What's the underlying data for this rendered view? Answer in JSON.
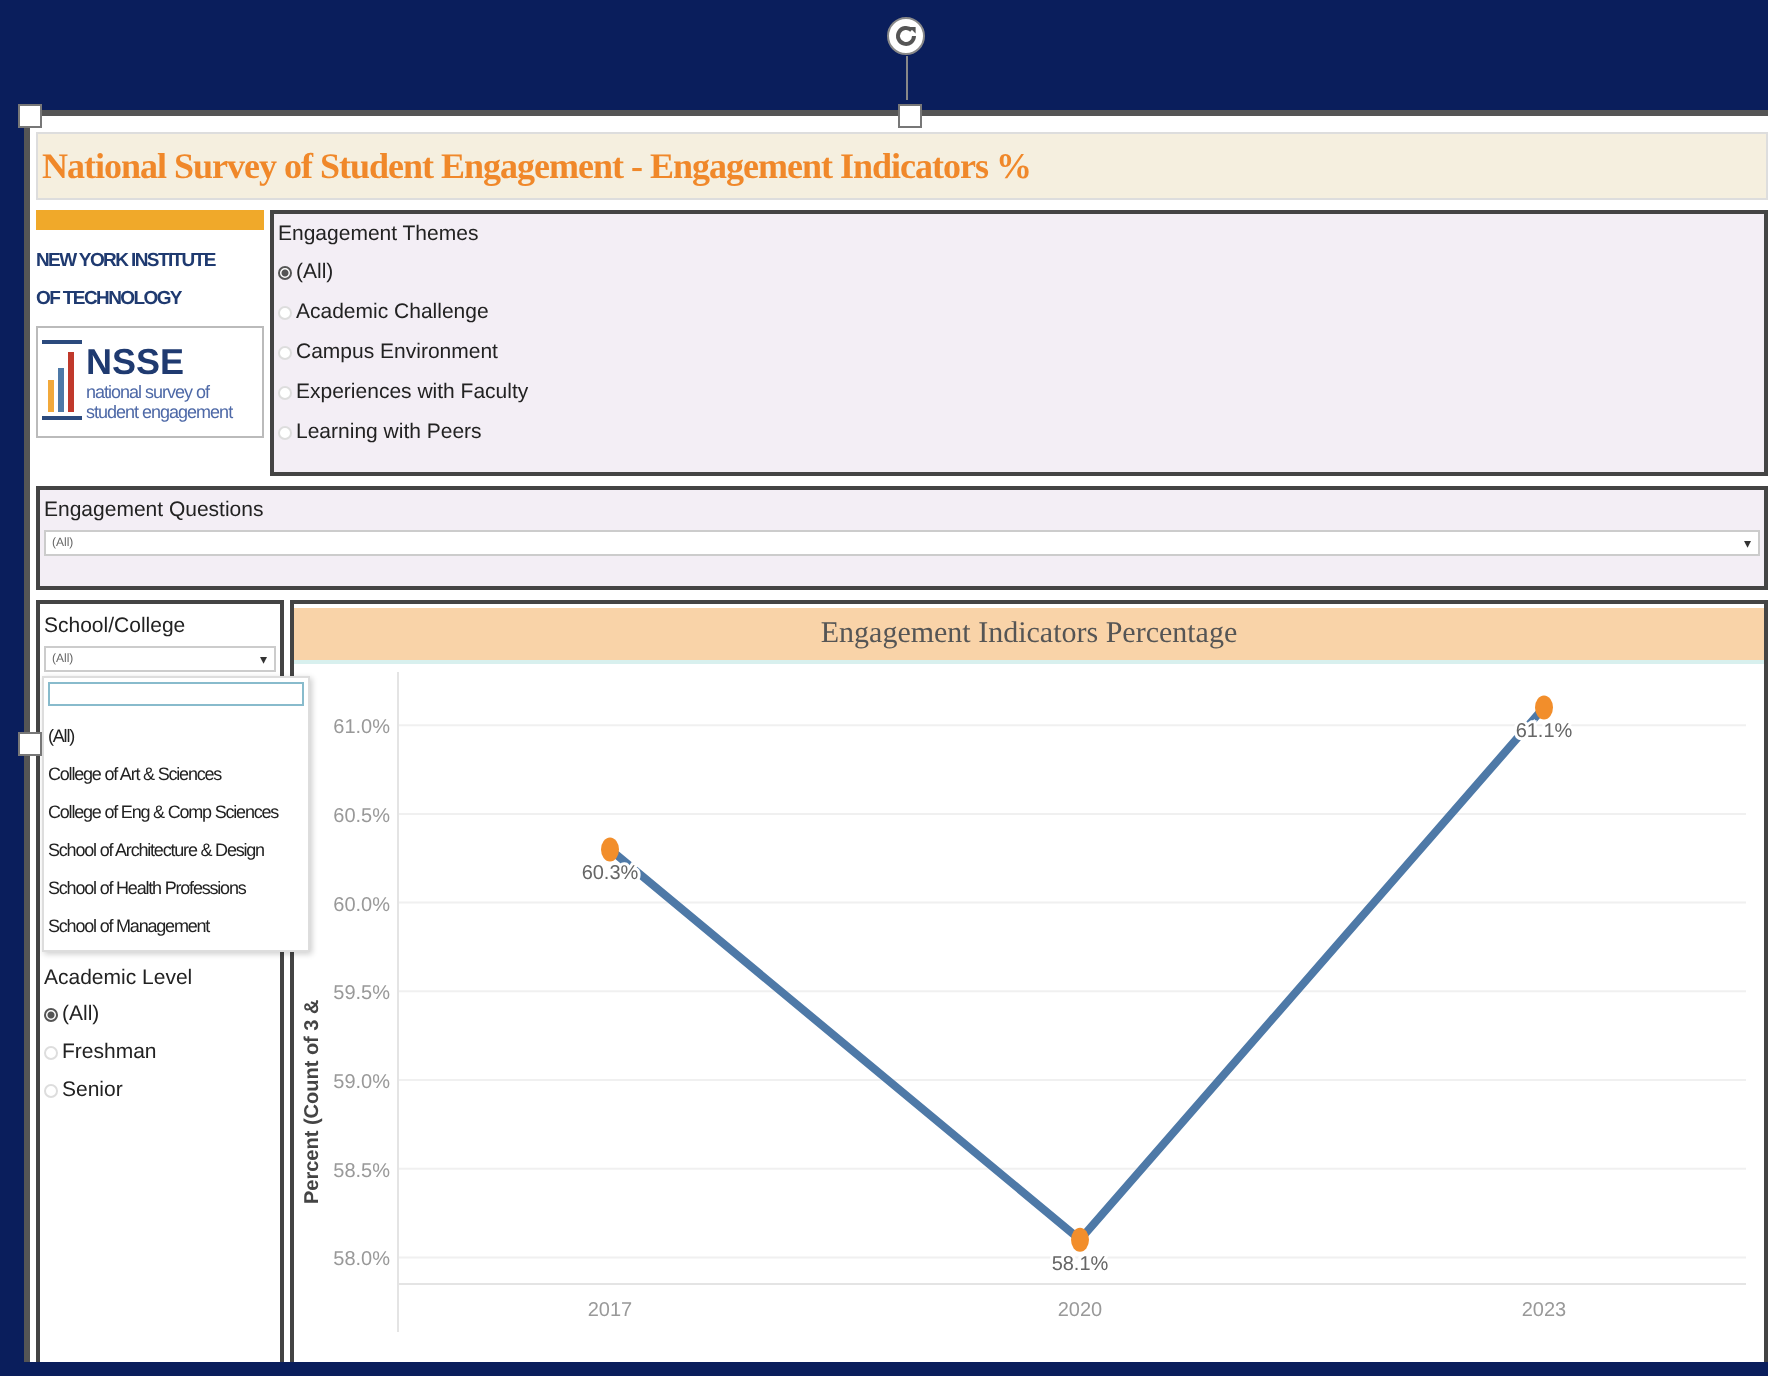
{
  "title": "National Survey of Student Engagement - Engagement Indicators %",
  "logo": {
    "institute_lines": [
      "NEW YORK INSTITUTE",
      "OF TECHNOLOGY"
    ],
    "acronym": "NSSE",
    "tagline_lines": [
      "national survey of",
      "student engagement"
    ]
  },
  "engagement_themes": {
    "label": "Engagement Themes",
    "options": [
      {
        "label": "(All)",
        "selected": true
      },
      {
        "label": "Academic Challenge",
        "selected": false
      },
      {
        "label": "Campus Environment",
        "selected": false
      },
      {
        "label": "Experiences with Faculty",
        "selected": false
      },
      {
        "label": "Learning with Peers",
        "selected": false
      }
    ]
  },
  "engagement_questions": {
    "label": "Engagement Questions",
    "value": "(All)",
    "caret": "▾"
  },
  "school_college": {
    "label": "School/College",
    "value": "(All)",
    "caret": "▾",
    "dropdown": {
      "expanded": true,
      "items": [
        {
          "label": "(All)"
        },
        {
          "label": "College of Art & Sciences"
        },
        {
          "label": "College of Eng & Comp Sciences"
        },
        {
          "label": "School of Architecture & Design"
        },
        {
          "label": "School of Health Professions"
        },
        {
          "label": "School of Management"
        }
      ]
    }
  },
  "academic_level": {
    "label": "Academic Level",
    "options": [
      {
        "label": "(All)",
        "selected": true
      },
      {
        "label": "Freshman",
        "selected": false
      },
      {
        "label": "Senior",
        "selected": false
      }
    ]
  },
  "chart_panel": {
    "header": "Engagement Indicators Percentage",
    "chart_data": {
      "type": "line",
      "ylabel": "Percent (Count of 3 &",
      "categories": [
        "2017",
        "2020",
        "2023"
      ],
      "series": [
        {
          "color": "#4e79a7",
          "marker": "circle",
          "values": [
            60.3,
            58.1,
            61.1
          ]
        }
      ],
      "value_labels": [
        "60.3%",
        "58.1%",
        "61.1%"
      ],
      "yticks": [
        {
          "value": 58.0,
          "label": "58.0%"
        },
        {
          "value": 58.5,
          "label": "58.5%"
        },
        {
          "value": 59.0,
          "label": "59.0%"
        },
        {
          "value": 59.5,
          "label": "59.5%"
        },
        {
          "value": 60.0,
          "label": "60.0%"
        },
        {
          "value": 60.5,
          "label": "60.5%"
        },
        {
          "value": 61.0,
          "label": "61.0%"
        }
      ],
      "ylim": [
        57.85,
        61.3
      ],
      "grid": true
    }
  }
}
